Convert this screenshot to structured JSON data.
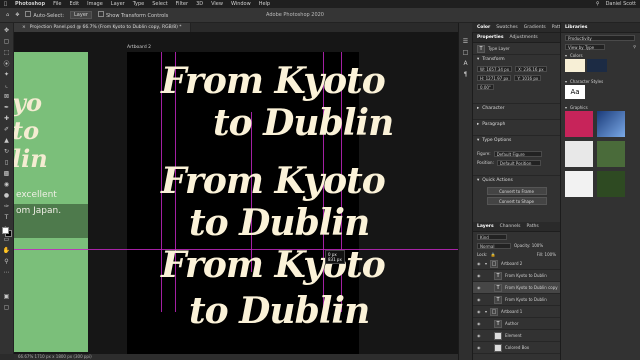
{
  "menubar": {
    "apple": "",
    "items": [
      "Photoshop",
      "File",
      "Edit",
      "Image",
      "Layer",
      "Type",
      "Select",
      "Filter",
      "3D",
      "View",
      "Window",
      "Help"
    ],
    "user": "Daniel Scott"
  },
  "optionsbar": {
    "auto_select_label": "Auto-Select:",
    "auto_select_value": "Layer",
    "transform_label": "Show Transform Controls"
  },
  "window_title": "Adobe Photoshop 2020",
  "doc_tab": "Projection Panel.psd @ 66.7% (From Kyoto to Dublin copy, RGB/8) *",
  "canvas": {
    "artboard_left_label": "",
    "artboard_right_label": "Artboard 2",
    "green_art_lines": [
      "yo",
      "to",
      "lin"
    ],
    "green_band_lines": [
      "excellent",
      "om Japan."
    ],
    "script_blocks": [
      {
        "line1": "From Kyoto",
        "line2": "to Dublin"
      },
      {
        "line1": "From Kyoto",
        "line2": "to Dublin"
      },
      {
        "line1": "From Kyoto",
        "line2": "to Dublin"
      }
    ],
    "measure_text": "0 px\n831 px"
  },
  "status": "66.67%     1710 px x 1800 px (300 ppi)",
  "properties_panel": {
    "tabs": [
      "Properties",
      "Adjustments"
    ],
    "layer_type": "Type Layer",
    "transform_title": "Transform",
    "w": "W: 1657.34 px",
    "h": "H: 1271.97 px",
    "x": "X: 236.16 px",
    "y": "Y: 1016 px",
    "angle": "0.00°",
    "character": "Character",
    "paragraph": "Paragraph",
    "type_options": "Type Options",
    "figure_label": "Figure:",
    "figure_value": "Default Figure",
    "position_label": "Position:",
    "position_value": "Default Position",
    "quick_actions": "Quick Actions",
    "btn_frame": "Convert to Frame",
    "btn_shape": "Convert to Shape"
  },
  "color_tabs": [
    "Color",
    "Swatches",
    "Gradients",
    "Patterns"
  ],
  "libraries": {
    "title": "Libraries",
    "library_name": "Productivity",
    "view_by": "View by Type",
    "colors_label": "Colors",
    "swatch_colors": [
      "#f7efd6",
      "#1c2b44"
    ],
    "char_styles_label": "Character Styles",
    "char_style_sample": "Aa",
    "graphics_label": "Graphics"
  },
  "layers_panel": {
    "tabs": [
      "Layers",
      "Channels",
      "Paths"
    ],
    "kind": "Kind",
    "mode": "Normal",
    "opacity": "Opacity: 100%",
    "lock": "Lock:",
    "fill": "Fill: 100%",
    "rows": [
      {
        "name": "Artboard 2",
        "type": "group",
        "selected": false
      },
      {
        "name": "From Kyoto to Dublin",
        "type": "text",
        "selected": false
      },
      {
        "name": "From Kyoto to Dublin copy",
        "type": "text",
        "selected": true
      },
      {
        "name": "From Kyoto to Dublin",
        "type": "text",
        "selected": false
      },
      {
        "name": "Artboard 1",
        "type": "group",
        "selected": false
      },
      {
        "name": "Author",
        "type": "text",
        "selected": false
      },
      {
        "name": "Element",
        "type": "layer",
        "selected": false
      },
      {
        "name": "Colored Box",
        "type": "layer",
        "selected": false
      }
    ]
  }
}
